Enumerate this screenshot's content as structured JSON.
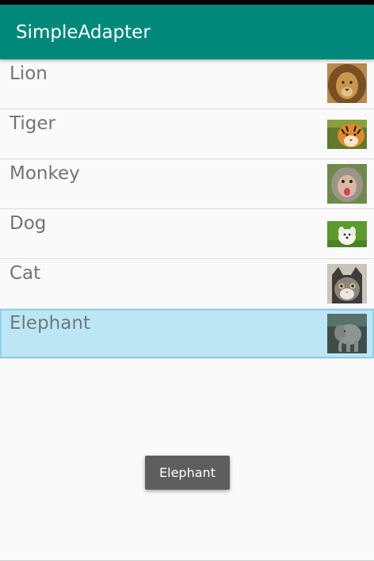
{
  "app": {
    "title": "SimpleAdapter",
    "primary_color": "#00897b",
    "selection_color": "#bde6f5"
  },
  "list": {
    "items": [
      {
        "label": "Lion",
        "image": "lion-photo",
        "selected": false
      },
      {
        "label": "Tiger",
        "image": "tiger-photo",
        "selected": false
      },
      {
        "label": "Monkey",
        "image": "monkey-photo",
        "selected": false
      },
      {
        "label": "Dog",
        "image": "dog-photo",
        "selected": false
      },
      {
        "label": "Cat",
        "image": "cat-photo",
        "selected": false
      },
      {
        "label": "Elephant",
        "image": "elephant-photo",
        "selected": true
      }
    ]
  },
  "toast": {
    "text": "Elephant"
  }
}
